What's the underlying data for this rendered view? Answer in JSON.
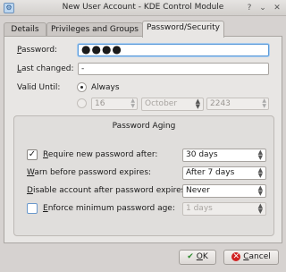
{
  "window": {
    "title": "New User Account - KDE Control Module",
    "icon": "app-icon"
  },
  "tabs": [
    {
      "label": "Details"
    },
    {
      "label": "Privileges and Groups"
    },
    {
      "label": "Password/Security",
      "active": true
    }
  ],
  "form": {
    "password_label": "Password:",
    "password_value": "●●●●",
    "last_changed_label": "Last changed:",
    "last_changed_value": "-",
    "valid_until_label": "Valid Until:",
    "always_label": "Always",
    "always_checked": true,
    "day_value": "16",
    "month_value": "October",
    "year_value": "2243"
  },
  "aging": {
    "title": "Password Aging",
    "require_new_label": "Require new password after:",
    "require_new_checked": true,
    "require_new_value": "30 days",
    "warn_label": "Warn before password expires:",
    "warn_value": "After 7 days",
    "disable_label": "Disable account after password expires:",
    "disable_value": "Never",
    "enforce_label": "Enforce minimum password age:",
    "enforce_checked": false,
    "enforce_value": "1 days"
  },
  "buttons": {
    "ok_label": "OK",
    "cancel_label": "Cancel"
  }
}
